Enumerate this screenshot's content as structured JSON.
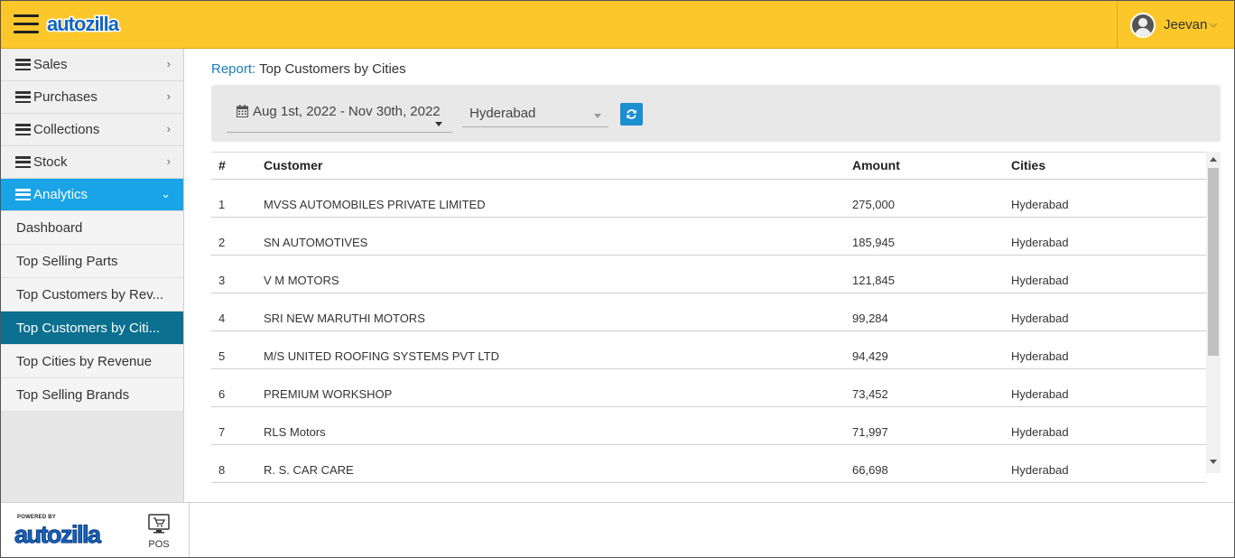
{
  "header": {
    "brand": "autozilla",
    "user_name": "Jeevan"
  },
  "sidebar": {
    "menu": [
      {
        "label": "Sales"
      },
      {
        "label": "Purchases"
      },
      {
        "label": "Collections"
      },
      {
        "label": "Stock"
      },
      {
        "label": "Analytics"
      }
    ],
    "analytics_items": [
      {
        "label": "Dashboard"
      },
      {
        "label": "Top Selling Parts"
      },
      {
        "label": "Top Customers by Rev..."
      },
      {
        "label": "Top Customers by Citi..."
      },
      {
        "label": "Top Cities by Revenue"
      },
      {
        "label": "Top Selling Brands"
      }
    ]
  },
  "footer": {
    "powered_by": "POWERED BY",
    "brand": "autozilla",
    "pos_label": "POS"
  },
  "breadcrumb": {
    "link": "Report",
    "separator": ":",
    "current": " Top Customers by Cities"
  },
  "filters": {
    "date_range": "Aug 1st, 2022 - Nov 30th, 2022",
    "city": "Hyderabad"
  },
  "table": {
    "columns": {
      "num": "#",
      "customer": "Customer",
      "amount": "Amount",
      "cities": "Cities"
    },
    "rows": [
      {
        "num": "1",
        "customer": "MVSS AUTOMOBILES PRIVATE LIMITED",
        "amount": "275,000",
        "city": "Hyderabad"
      },
      {
        "num": "2",
        "customer": "SN AUTOMOTIVES",
        "amount": "185,945",
        "city": "Hyderabad"
      },
      {
        "num": "3",
        "customer": "V M MOTORS",
        "amount": "121,845",
        "city": "Hyderabad"
      },
      {
        "num": "4",
        "customer": "SRI NEW MARUTHI MOTORS",
        "amount": "99,284",
        "city": "Hyderabad"
      },
      {
        "num": "5",
        "customer": "M/S UNITED ROOFING SYSTEMS PVT LTD",
        "amount": "94,429",
        "city": "Hyderabad"
      },
      {
        "num": "6",
        "customer": "PREMIUM WORKSHOP",
        "amount": "73,452",
        "city": "Hyderabad"
      },
      {
        "num": "7",
        "customer": "RLS Motors",
        "amount": "71,997",
        "city": "Hyderabad"
      },
      {
        "num": "8",
        "customer": "R. S. CAR CARE",
        "amount": "66,698",
        "city": "Hyderabad"
      }
    ]
  },
  "colors": {
    "header_bg": "#fcc72b",
    "active_menu": "#18a4e6",
    "selected_item": "#0b6f8f",
    "link": "#1b7fb8",
    "brand_blue": "#1565c0"
  }
}
